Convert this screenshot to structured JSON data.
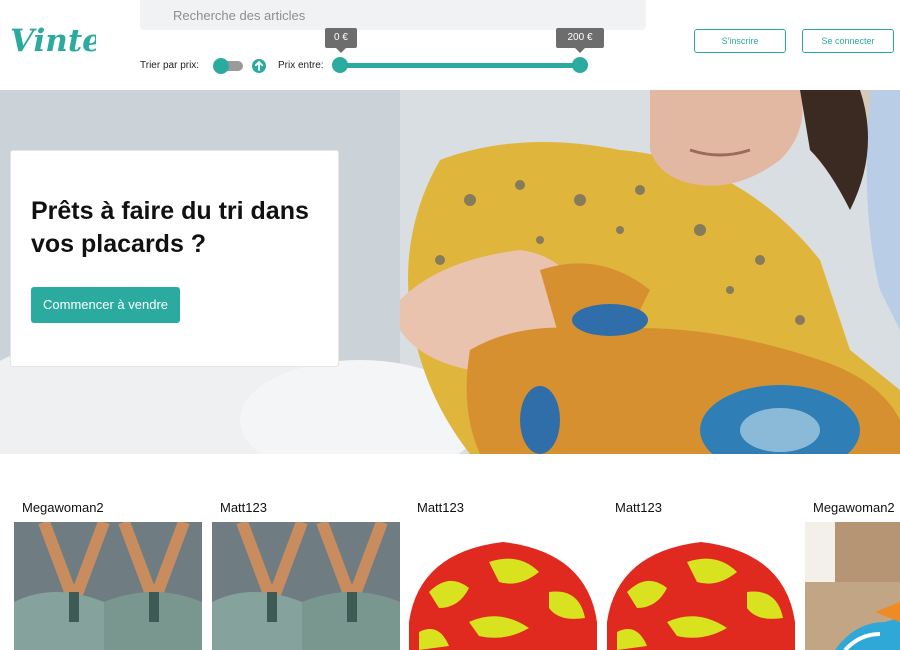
{
  "brand": {
    "logo_text": "Vinted",
    "accent_color": "#2bab9f"
  },
  "search": {
    "placeholder": "Recherche des articles",
    "value": ""
  },
  "filters": {
    "sort_label": "Trier par prix:",
    "sort_toggle_on": false,
    "sort_direction_icon": "arrow-up-icon",
    "price_label": "Prix entre:",
    "price_min": "0 €",
    "price_max": "200 €"
  },
  "auth": {
    "signup_label": "S'inscrire",
    "login_label": "Se connecter"
  },
  "hero": {
    "title": "Prêts à faire du tri dans vos placards ?",
    "cta_label": "Commencer à vendre"
  },
  "items": [
    {
      "user": "Megawoman2",
      "image": "hangers-photo"
    },
    {
      "user": "Matt123",
      "image": "hangers-photo"
    },
    {
      "user": "Matt123",
      "image": "bucket-hat-photo"
    },
    {
      "user": "Matt123",
      "image": "bucket-hat-photo"
    },
    {
      "user": "Megawoman2",
      "image": "sneakers-photo"
    }
  ]
}
